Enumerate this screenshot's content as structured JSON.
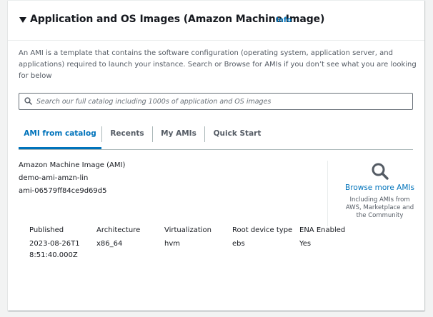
{
  "section": {
    "title": "Application and OS Images (Amazon Machine Image)",
    "info_label": "Info",
    "description": "An AMI is a template that contains the software configuration (operating system, application server, and applications) required to launch your instance. Search or Browse for AMIs if you don’t see what you are looking for below"
  },
  "search": {
    "placeholder": "Search our full catalog including 1000s of application and OS images",
    "value": ""
  },
  "tabs": [
    {
      "label": "AMI from catalog",
      "active": true
    },
    {
      "label": "Recents",
      "active": false
    },
    {
      "label": "My AMIs",
      "active": false
    },
    {
      "label": "Quick Start",
      "active": false
    }
  ],
  "ami": {
    "heading": "Amazon Machine Image (AMI)",
    "name": "demo-ami-amzn-lin",
    "id": "ami-06579ff84ce9d69d5"
  },
  "browse": {
    "link_label": "Browse more AMIs",
    "note": "Including AMIs from AWS, Marketplace and the Community"
  },
  "details": [
    {
      "label": "Published",
      "value": "2023-08-26T18:51:40.000Z"
    },
    {
      "label": "Architecture",
      "value": "x86_64"
    },
    {
      "label": "Virtualization",
      "value": "hvm"
    },
    {
      "label": "Root device type",
      "value": "ebs"
    },
    {
      "label": "ENA Enabled",
      "value": "Yes"
    }
  ],
  "colors": {
    "link": "#0073bb",
    "text": "#16191f",
    "muted": "#545b64",
    "background": "#f2f3f3"
  }
}
